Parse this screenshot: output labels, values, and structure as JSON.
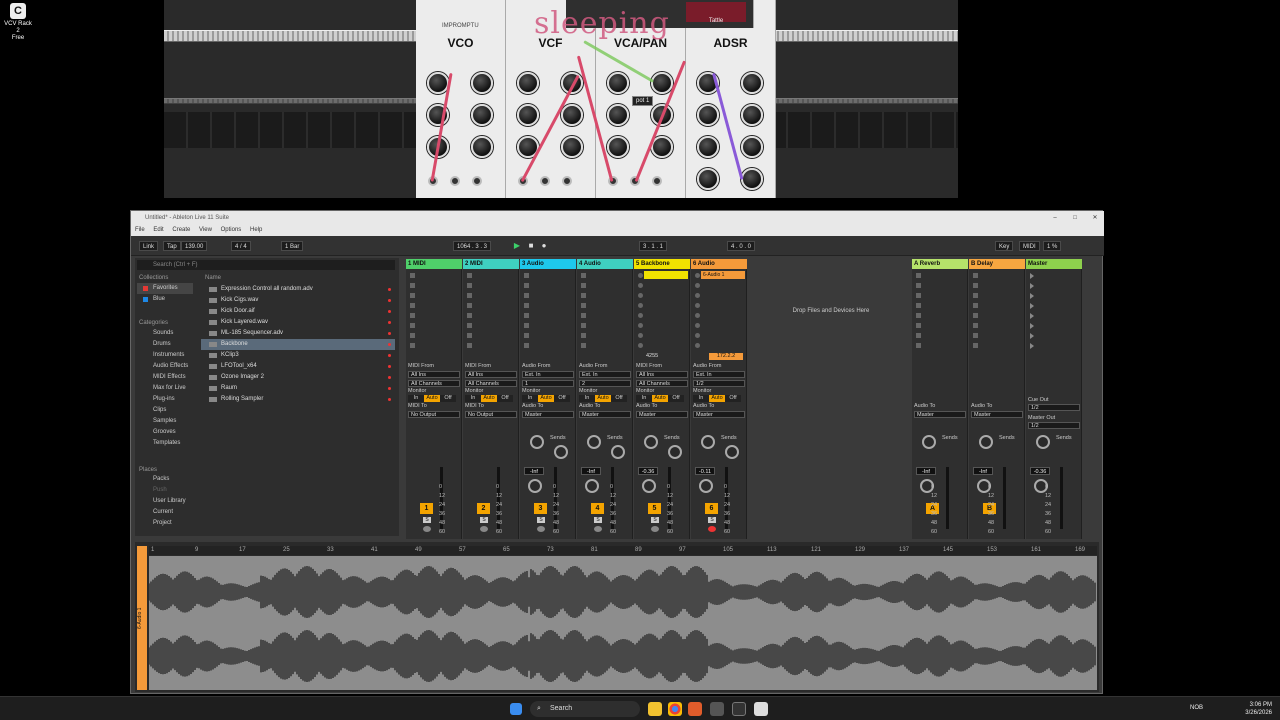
{
  "desktop": {
    "icon_label_line1": "VCV Rack 2",
    "icon_label_line2": "Free"
  },
  "vcv": {
    "brand": "IMPROMPTU",
    "modules": [
      "VCO",
      "VCF",
      "VCA/PAN",
      "ADSR"
    ],
    "watermark": "sleeping",
    "tooltip": "pot 1",
    "module_label": "Tattle"
  },
  "live": {
    "title": "Untitled* - Ableton Live 11 Suite",
    "menu": [
      "File",
      "Edit",
      "Create",
      "View",
      "Options",
      "Help"
    ],
    "control": {
      "link": "Link",
      "tap": "Tap",
      "tempo": "139.00",
      "signature": "4 / 4",
      "quantize": "1 Bar",
      "position": "1064 . 3 . 3",
      "loop_start": "3 . 1 . 1",
      "loop_len": "4 . 0 . 0",
      "key": "Key",
      "midi": "MIDI",
      "cpu": "1 %"
    },
    "browser": {
      "search_placeholder": "Search (Ctrl + F)",
      "collections_header": "Collections",
      "collections": [
        {
          "label": "Favorites",
          "color": "#e53935"
        },
        {
          "label": "Blue",
          "color": "#1e88e5"
        }
      ],
      "categories_header": "Categories",
      "categories": [
        "Sounds",
        "Drums",
        "Instruments",
        "Audio Effects",
        "MIDI Effects",
        "Max for Live",
        "Plug-ins",
        "Clips",
        "Samples",
        "Grooves",
        "Templates"
      ],
      "places_header": "Places",
      "places": [
        "Packs",
        "Push",
        "User Library",
        "Current Project"
      ],
      "name_header": "Name",
      "files": [
        "Expression Control all random.adv",
        "Kick Cigs.wav",
        "Kick Door.aif",
        "Kick Layered.wav",
        "ML-185 Sequencer.adv",
        "Backbone",
        "KClip3",
        "LFOTool_x64",
        "Ozone Imager 2",
        "Raum",
        "Rolling Sampler"
      ]
    },
    "tracks": [
      {
        "name": "1 MIDI",
        "color": "#4fd06a",
        "input_label": "MIDI From",
        "input": "All Ins",
        "channel": "All Channels",
        "output_label": "MIDI To",
        "output": "No Output",
        "num": "1"
      },
      {
        "name": "2 MIDI",
        "color": "#3fd0c0",
        "input_label": "MIDI From",
        "input": "All Ins",
        "channel": "All Channels",
        "output_label": "MIDI To",
        "output": "No Output",
        "num": "2"
      },
      {
        "name": "3 Audio",
        "color": "#1ec8ec",
        "input_label": "Audio From",
        "input": "Ext. In",
        "channel": "1",
        "output_label": "Audio To",
        "output": "Master",
        "num": "3",
        "vol": "-Inf"
      },
      {
        "name": "4 Audio",
        "color": "#3fd0c0",
        "input_label": "Audio From",
        "input": "Ext. In",
        "channel": "2",
        "output_label": "Audio To",
        "output": "Master",
        "num": "4",
        "vol": "-Inf"
      },
      {
        "name": "5 Backbone",
        "color": "#f1e200",
        "input_label": "MIDI From",
        "input": "All Ins",
        "channel": "All Channels",
        "output_label": "Audio To",
        "output": "Master",
        "num": "5",
        "vol": "-0.36"
      },
      {
        "name": "6 Audio",
        "color": "#f49a3a",
        "input_label": "Audio From",
        "input": "Ext. In",
        "channel": "1/2",
        "output_label": "Audio To",
        "output": "Master",
        "num": "6",
        "vol": "-0.11"
      }
    ],
    "clip_6": "6-Audio 1",
    "slot_5": "4255",
    "slot_6": "172.2.2",
    "returns": [
      {
        "name": "A Reverb",
        "color": "#b5e26a",
        "num": "A",
        "vol": "-Inf",
        "output": "Master"
      },
      {
        "name": "B Delay",
        "color": "#f6a640",
        "num": "B",
        "vol": "-Inf",
        "output": "Master"
      },
      {
        "name": "Master",
        "color": "#8ed14d",
        "vol": "-0.36",
        "cue_label": "Cue Out",
        "cue": "1/2",
        "master_label": "Master Out",
        "master_out": "1/2"
      }
    ],
    "drop_text": "Drop Files and Devices Here",
    "monitor_label": "Monitor",
    "monitor": [
      "In",
      "Auto",
      "Off"
    ],
    "sends_label": "Sends",
    "db_scale": [
      "0",
      "12",
      "24",
      "36",
      "48",
      "60"
    ],
    "ruler": [
      "1",
      "9",
      "17",
      "25",
      "33",
      "41",
      "49",
      "57",
      "65",
      "73",
      "81",
      "89",
      "97",
      "105",
      "113",
      "121",
      "129",
      "137",
      "145",
      "153",
      "161",
      "169"
    ],
    "arr_track": "6-Audio 1"
  },
  "taskbar": {
    "search": "Search",
    "lang": "NOB",
    "time": "3:06 PM",
    "date": "3/26/2026"
  }
}
